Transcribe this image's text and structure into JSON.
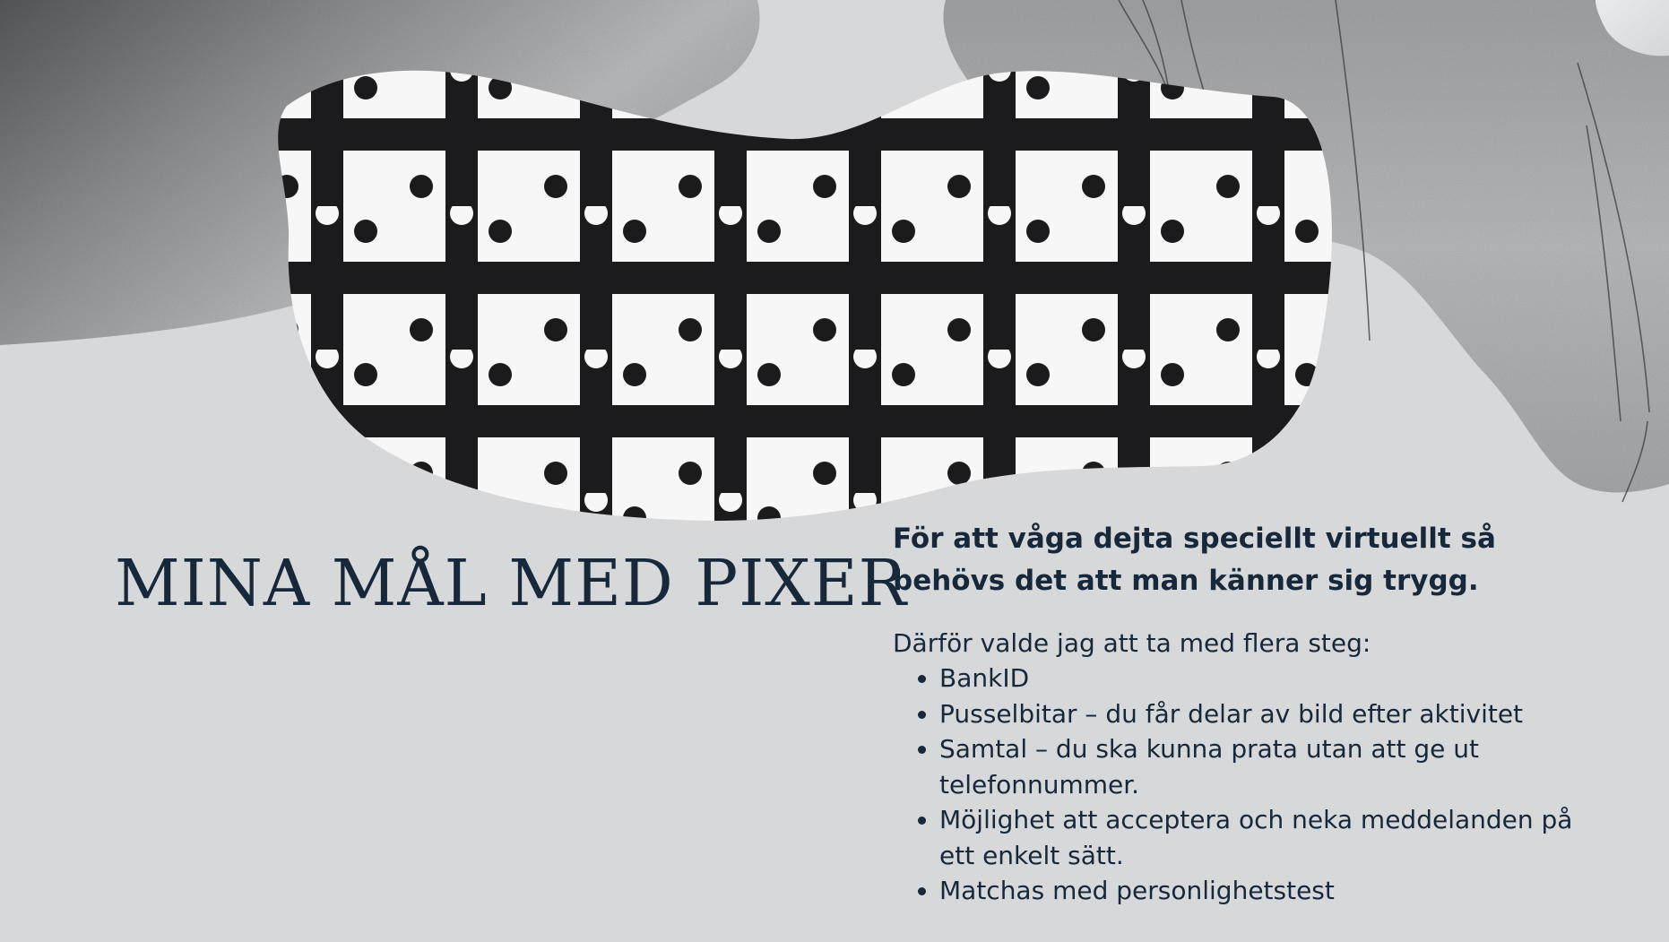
{
  "slide": {
    "title": "MINA MÅL MED PIXER",
    "lead": "För att våga dejta speciellt virtuellt så behövs det att man känner sig trygg.",
    "intro": "Därför valde jag att ta med flera steg:",
    "steps": [
      "BankID",
      "Pusselbitar – du får delar av bild efter aktivitet",
      "Samtal – du ska kunna prata utan att ge ut telefonnummer.",
      "Möjlighet att acceptera och neka meddelanden på ett enkelt sätt.",
      "Matchas med personlighetstest"
    ]
  },
  "colors": {
    "background": "#d6d8da",
    "text": "#16283a",
    "puzzle_dark": "#1b1b1d",
    "puzzle_light": "#f7f7f7"
  }
}
